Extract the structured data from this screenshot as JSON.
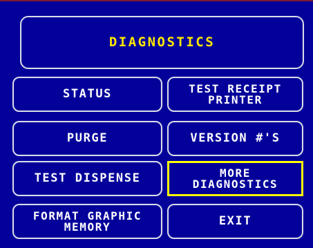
{
  "screen": {
    "title": "DIAGNOSTICS"
  },
  "buttons": {
    "status": "STATUS",
    "test_receipt_printer": "TEST RECEIPT\nPRINTER",
    "purge": "PURGE",
    "version_numbers": "VERSION #'S",
    "test_dispense": "TEST DISPENSE",
    "more_diagnostics": "MORE\nDIAGNOSTICS",
    "format_graphic_memory": "FORMAT GRAPHIC\nMEMORY",
    "exit": "EXIT"
  },
  "colors": {
    "background": "#04019a",
    "title_text": "#ffe800",
    "button_text": "#ffffff",
    "border": "#d9dce8",
    "highlight": "#ffff00"
  }
}
